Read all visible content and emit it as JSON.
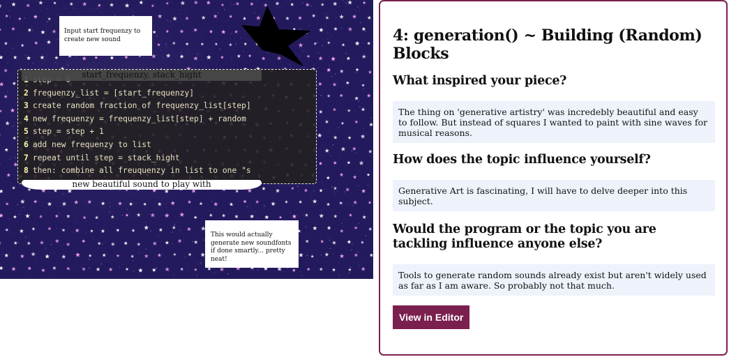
{
  "canvas": {
    "background_color": "#231a5e",
    "star_colors": [
      "#ffffff",
      "#f3a6e6"
    ],
    "note_input": "Input start frequenzy to create new sound",
    "note_generate": "This would actually generate new soundfonts if done smartly... pretty neat!",
    "code_label_top": "start_frequenzy, stack_hight",
    "code_label_bottom": "new beautiful sound to play with",
    "code_lines": [
      {
        "num": "1",
        "text": "step = 0"
      },
      {
        "num": "2",
        "text": "frequenzy_list = [start_frequenzy]"
      },
      {
        "num": "3",
        "text": "create random fraction of frequenzy_list[step]"
      },
      {
        "num": "4",
        "text": "new frequenzy = frequenzy_list[step] + random"
      },
      {
        "num": "5",
        "text": "step = step + 1"
      },
      {
        "num": "6",
        "text": "add new frequenzy to list"
      },
      {
        "num": "7",
        "text": "repeat until step = stack_hight"
      },
      {
        "num": "8",
        "text": "then: combine all freuquenzy in list to one \"s"
      }
    ]
  },
  "panel": {
    "accent_color": "#7b1f4f",
    "title": "4: generation() ~ Building (Random) Blocks",
    "questions": [
      {
        "question": "What inspired your piece?",
        "answer": "The thing on 'generative artistry' was incredebly beautiful and easy to follow. But instead of squares I wanted to paint with sine waves for musical reasons."
      },
      {
        "question": "How does the topic influence yourself?",
        "answer": "Generative Art is fascinating, I will have to delve deeper into this subject."
      },
      {
        "question": "Would the program or the topic you are tackling influence anyone else?",
        "answer": "Tools to generate random sounds already exist but aren't widely used as far as I am aware. So probably not that much."
      }
    ],
    "button_label": "View in Editor"
  }
}
